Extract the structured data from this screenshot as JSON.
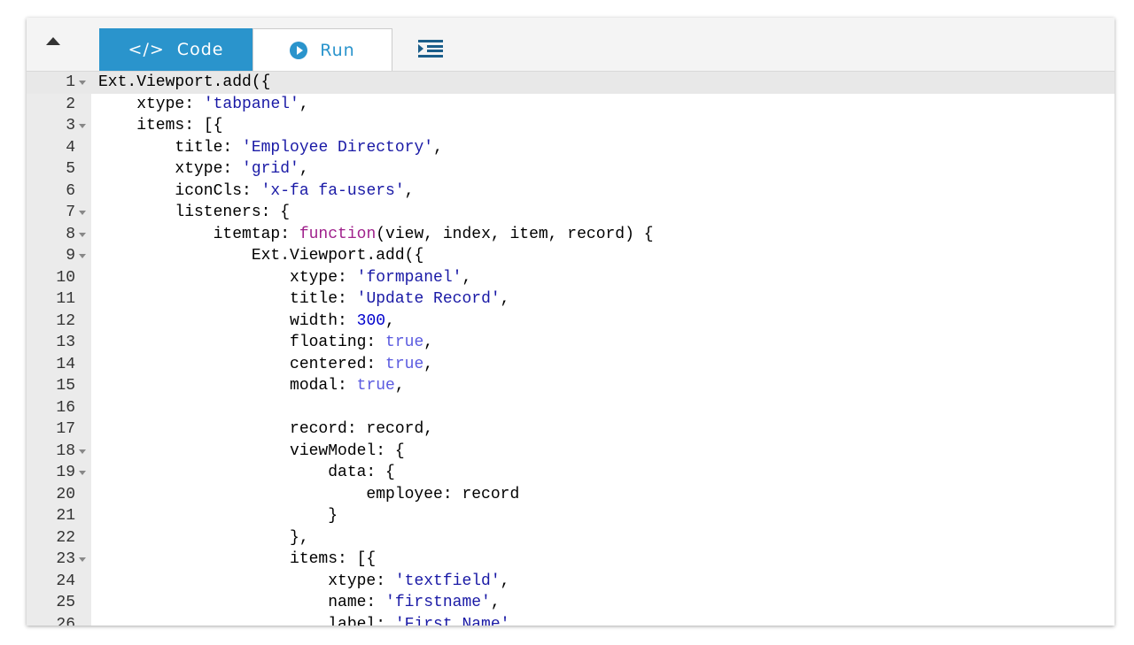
{
  "toolbar": {
    "code_tab": "Code",
    "run_tab": "Run",
    "colors": {
      "accent": "#2a94cc"
    }
  },
  "editor": {
    "lines": [
      {
        "n": "1",
        "fold": true,
        "lvl": 0,
        "t": [
          [
            "p",
            "Ext.Viewport.add({"
          ]
        ]
      },
      {
        "n": "2",
        "lvl": 1,
        "t": [
          [
            "p",
            "xtype: "
          ],
          [
            "str",
            "'tabpanel'"
          ],
          [
            "p",
            ","
          ]
        ]
      },
      {
        "n": "3",
        "fold": true,
        "lvl": 1,
        "t": [
          [
            "p",
            "items: [{"
          ]
        ]
      },
      {
        "n": "4",
        "lvl": 2,
        "t": [
          [
            "p",
            "title: "
          ],
          [
            "str",
            "'Employee Directory'"
          ],
          [
            "p",
            ","
          ]
        ]
      },
      {
        "n": "5",
        "lvl": 2,
        "t": [
          [
            "p",
            "xtype: "
          ],
          [
            "str",
            "'grid'"
          ],
          [
            "p",
            ","
          ]
        ]
      },
      {
        "n": "6",
        "lvl": 2,
        "t": [
          [
            "p",
            "iconCls: "
          ],
          [
            "str",
            "'x-fa fa-users'"
          ],
          [
            "p",
            ","
          ]
        ]
      },
      {
        "n": "7",
        "fold": true,
        "lvl": 2,
        "t": [
          [
            "p",
            "listeners: {"
          ]
        ]
      },
      {
        "n": "8",
        "fold": true,
        "lvl": 3,
        "t": [
          [
            "p",
            "itemtap: "
          ],
          [
            "kw",
            "function"
          ],
          [
            "p",
            "(view, index, item, record) {"
          ]
        ]
      },
      {
        "n": "9",
        "fold": true,
        "lvl": 4,
        "t": [
          [
            "p",
            "Ext.Viewport.add({"
          ]
        ]
      },
      {
        "n": "10",
        "lvl": 5,
        "t": [
          [
            "p",
            "xtype: "
          ],
          [
            "str",
            "'formpanel'"
          ],
          [
            "p",
            ","
          ]
        ]
      },
      {
        "n": "11",
        "lvl": 5,
        "t": [
          [
            "p",
            "title: "
          ],
          [
            "str",
            "'Update Record'"
          ],
          [
            "p",
            ","
          ]
        ]
      },
      {
        "n": "12",
        "lvl": 5,
        "t": [
          [
            "p",
            "width: "
          ],
          [
            "num",
            "300"
          ],
          [
            "p",
            ","
          ]
        ]
      },
      {
        "n": "13",
        "lvl": 5,
        "t": [
          [
            "p",
            "floating: "
          ],
          [
            "bool",
            "true"
          ],
          [
            "p",
            ","
          ]
        ]
      },
      {
        "n": "14",
        "lvl": 5,
        "t": [
          [
            "p",
            "centered: "
          ],
          [
            "bool",
            "true"
          ],
          [
            "p",
            ","
          ]
        ]
      },
      {
        "n": "15",
        "lvl": 5,
        "t": [
          [
            "p",
            "modal: "
          ],
          [
            "bool",
            "true"
          ],
          [
            "p",
            ","
          ]
        ]
      },
      {
        "n": "16",
        "lvl": 0,
        "t": []
      },
      {
        "n": "17",
        "lvl": 5,
        "t": [
          [
            "p",
            "record: record,"
          ]
        ]
      },
      {
        "n": "18",
        "fold": true,
        "lvl": 5,
        "t": [
          [
            "p",
            "viewModel: {"
          ]
        ]
      },
      {
        "n": "19",
        "fold": true,
        "lvl": 6,
        "t": [
          [
            "p",
            "data: {"
          ]
        ]
      },
      {
        "n": "20",
        "lvl": 7,
        "t": [
          [
            "p",
            "employee: record"
          ]
        ]
      },
      {
        "n": "21",
        "lvl": 6,
        "t": [
          [
            "p",
            "}"
          ]
        ]
      },
      {
        "n": "22",
        "lvl": 5,
        "t": [
          [
            "p",
            "},"
          ]
        ]
      },
      {
        "n": "23",
        "fold": true,
        "lvl": 5,
        "t": [
          [
            "p",
            "items: [{"
          ]
        ]
      },
      {
        "n": "24",
        "lvl": 6,
        "t": [
          [
            "p",
            "xtype: "
          ],
          [
            "str",
            "'textfield'"
          ],
          [
            "p",
            ","
          ]
        ]
      },
      {
        "n": "25",
        "lvl": 6,
        "t": [
          [
            "p",
            "name: "
          ],
          [
            "str",
            "'firstname'"
          ],
          [
            "p",
            ","
          ]
        ]
      },
      {
        "n": "26",
        "lvl": 6,
        "t": [
          [
            "p",
            "label: "
          ],
          [
            "str",
            "'First Name'"
          ],
          [
            "p",
            ","
          ]
        ]
      }
    ]
  }
}
